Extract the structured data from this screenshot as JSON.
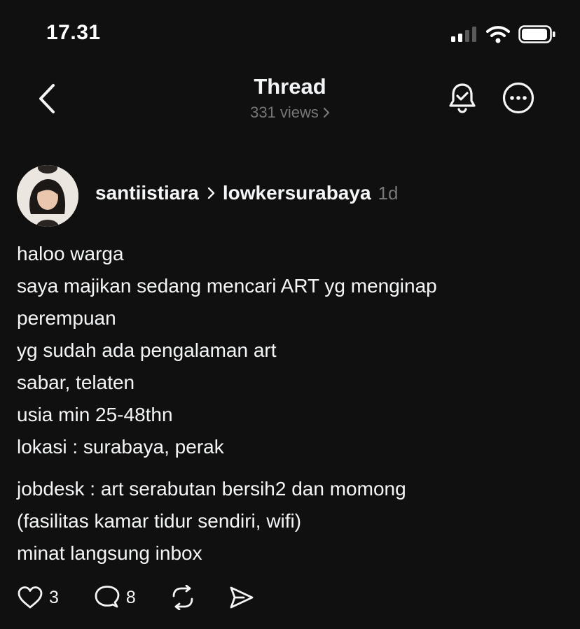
{
  "status_bar": {
    "time": "17.31"
  },
  "nav": {
    "title": "Thread",
    "views": "331 views",
    "icons": {
      "back": "chevron-left-icon",
      "views_chevron": "chevron-right-icon",
      "notifications": "bell-check-icon",
      "more": "more-circle-icon"
    }
  },
  "post": {
    "author": "santiistiara",
    "community": "lowkersurabaya",
    "age": "1d",
    "lines_para1": [
      "haloo warga",
      "saya majikan sedang mencari ART yg menginap",
      "perempuan",
      "yg sudah ada pengalaman art",
      "sabar, telaten",
      "usia min 25-48thn",
      "lokasi : surabaya, perak"
    ],
    "lines_para2": [
      "jobdesk : art serabutan bersih2 dan momong",
      "(fasilitas kamar tidur sendiri, wifi)",
      "minat langsung inbox"
    ],
    "actions": {
      "likes": "3",
      "replies": "8",
      "icons": [
        "heart-icon",
        "reply-icon",
        "repost-icon",
        "share-icon"
      ]
    }
  },
  "colors": {
    "background": "#101010",
    "text": "#f3f5f7",
    "muted": "#777777"
  }
}
